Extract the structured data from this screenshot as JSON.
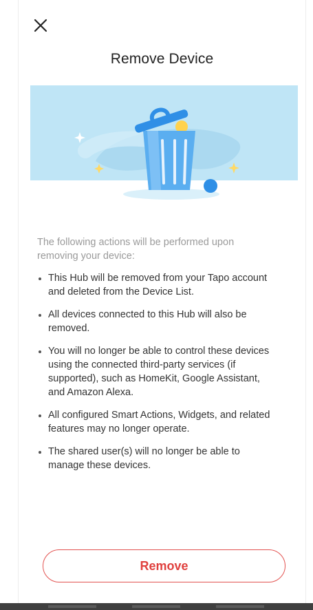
{
  "header": {
    "close_icon": "close-icon",
    "title": "Remove Device"
  },
  "hero": {
    "illustration": "trash-can-icon",
    "background_color": "#bfe5f6",
    "accent_color": "#2f8fe6"
  },
  "content": {
    "intro": "The following actions will be performed upon removing your device:",
    "items": [
      "This Hub will be removed from your Tapo account and deleted from the Device List.",
      "All devices connected to this Hub will also be removed.",
      "You will no longer be able to control these devices using the connected third-party services (if supported), such as HomeKit, Google Assistant, and Amazon Alexa.",
      "All configured Smart Actions, Widgets, and related features may no longer operate.",
      "The shared user(s) will no longer be able to manage these devices."
    ]
  },
  "footer": {
    "remove_label": "Remove",
    "remove_color": "#e0403e"
  }
}
